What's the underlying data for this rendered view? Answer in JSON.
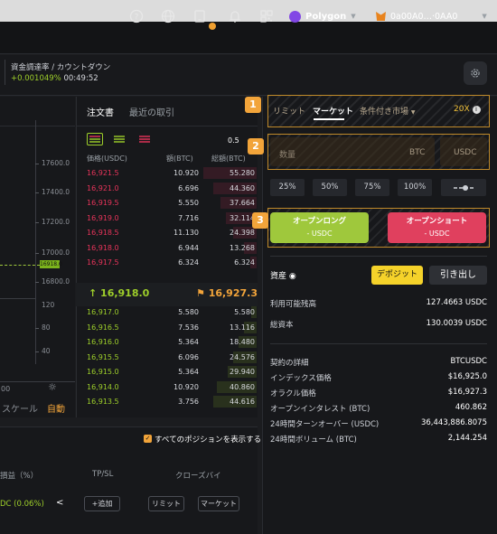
{
  "header": {
    "network": "Polygon",
    "wallet": "0a00A0…·0AA0"
  },
  "infobar": {
    "funding_label": "資金調達率 / カウントダウン",
    "funding_rate": "+0.001049%",
    "countdown": "00:49:52"
  },
  "chart": {
    "ticks": [
      "17600.0",
      "17400.0",
      "17200.0",
      "17000.0",
      "16800.0",
      "120",
      "80",
      "40"
    ],
    "last_price_tag": "16918.0",
    "bottom_left": "00",
    "scale_label": "スケール",
    "auto_label": "自動"
  },
  "orderbook": {
    "tab_book": "注文書",
    "tab_trades": "最近の取引",
    "step": "0.5",
    "col_price": "価格(USDC)",
    "col_amount": "額(BTC)",
    "col_total": "総額(BTC)",
    "asks": [
      {
        "p": "16,921.5",
        "a": "10.920",
        "t": "55.280"
      },
      {
        "p": "16,921.0",
        "a": "6.696",
        "t": "44.360"
      },
      {
        "p": "16,919.5",
        "a": "5.550",
        "t": "37.664"
      },
      {
        "p": "16,919.0",
        "a": "7.716",
        "t": "32.114"
      },
      {
        "p": "16,918.5",
        "a": "11.130",
        "t": "24.398"
      },
      {
        "p": "16,918.0",
        "a": "6.944",
        "t": "13.268"
      },
      {
        "p": "16,917.5",
        "a": "6.324",
        "t": "6.324"
      }
    ],
    "mid_last": "↑ 16,918.0",
    "mid_mark": "⚑ 16,927.3",
    "bids": [
      {
        "p": "16,917.0",
        "a": "5.580",
        "t": "5.580"
      },
      {
        "p": "16,916.5",
        "a": "7.536",
        "t": "13.116"
      },
      {
        "p": "16,916.0",
        "a": "5.364",
        "t": "18.480"
      },
      {
        "p": "16,915.5",
        "a": "6.096",
        "t": "24.576"
      },
      {
        "p": "16,915.0",
        "a": "5.364",
        "t": "29.940"
      },
      {
        "p": "16,914.0",
        "a": "10.920",
        "t": "40.860"
      },
      {
        "p": "16,913.5",
        "a": "3.756",
        "t": "44.616"
      }
    ]
  },
  "positions": {
    "show_all": "すべてのポジションを表示する",
    "col_pnl": "損益（%）",
    "col_tpsl": "TP/SL",
    "col_close": "クローズバイ",
    "pnl_value": "DC (0.06%)",
    "add_btn": "+追加",
    "limit_btn": "リミット",
    "market_btn": "マーケット"
  },
  "order_panel": {
    "tab_limit": "リミット",
    "tab_market": "マーケット",
    "tab_conditional": "条件付き市場",
    "leverage": "20X",
    "amount_placeholder": "数量",
    "unit_btc": "BTC",
    "unit_usdc": "USDC",
    "percents": [
      "25%",
      "50%",
      "75%",
      "100%"
    ],
    "open_long": "オープンロング",
    "open_long_sub": "- USDC",
    "open_short": "オープンショート",
    "open_short_sub": "- USDC",
    "badges": [
      "1",
      "2",
      "3"
    ]
  },
  "assets": {
    "title": "資産",
    "deposit": "デポジット",
    "withdraw": "引き出し",
    "available_label": "利用可能残高",
    "available_value": "127.4663 USDC",
    "total_label": "総資本",
    "total_value": "130.0039 USDC"
  },
  "contract": {
    "rows": [
      {
        "k": "契約の詳細",
        "v": "BTCUSDC"
      },
      {
        "k": "インデックス価格",
        "v": "$16,925.0"
      },
      {
        "k": "オラクル価格",
        "v": "$16,927.3"
      },
      {
        "k": "オープンインタレスト (BTC)",
        "v": "460.862"
      },
      {
        "k": "24時間ターンオーバー (USDC)",
        "v": "36,443,886.8075"
      },
      {
        "k": "24時間ボリューム (BTC)",
        "v": "2,144.254"
      }
    ]
  },
  "colors": {
    "ask": "#e8345a",
    "bid": "#9ecf2a",
    "accent": "#f2a43a"
  }
}
